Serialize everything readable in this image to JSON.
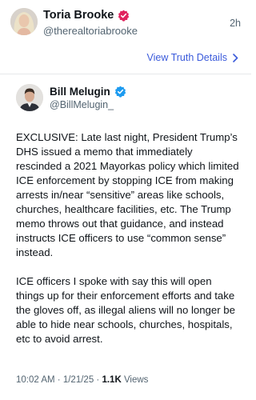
{
  "post": {
    "author_name": "Toria Brooke",
    "author_handle": "@therealtoriabrooke",
    "time_ago": "2h",
    "view_details_label": "View Truth Details"
  },
  "embedded": {
    "author_name": "Bill Melugin",
    "author_handle": "@BillMelugin_",
    "paragraphs": [
      "EXCLUSIVE: Late last night, President Trump’s DHS issued a memo that immediately rescinded a 2021 Mayorkas policy which limited ICE enforcement by stopping ICE from making arrests in/near “sensitive” areas like schools, churches, healthcare facilities, etc. The Trump memo throws out that guidance, and instead instructs ICE officers to use “common sense” instead.",
      "ICE officers I spoke with say this will open things up for their enforcement efforts and take the gloves off, as illegal aliens will no longer be able to hide near schools, churches, hospitals, etc to avoid arrest."
    ],
    "time": "10:02 AM",
    "separator": "·",
    "date": "1/21/25",
    "views_count": "1.1K",
    "views_label": "Views"
  },
  "colors": {
    "badge_pink": "#e0245e",
    "badge_blue": "#1d9bf0",
    "link": "#3b5bdb"
  },
  "icons": {
    "post_badge": "verified-badge-icon",
    "embedded_badge": "verified-badge-icon",
    "view_link": "chevron-right-icon"
  }
}
